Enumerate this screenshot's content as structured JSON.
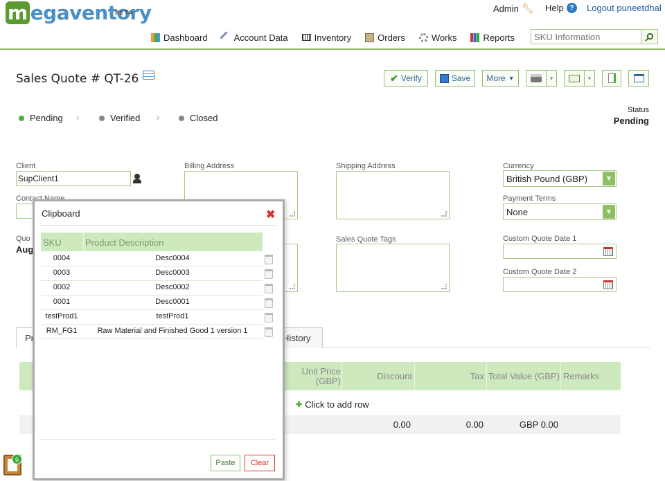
{
  "header": {
    "logo_text": "egaventory",
    "logo_m": "m",
    "logo_beta": "BETA",
    "admin": "Admin",
    "help": "Help",
    "logout": "Logout puneetdhal",
    "nav": [
      "Dashboard",
      "Account Data",
      "Inventory",
      "Orders",
      "Works",
      "Reports"
    ],
    "search_placeholder": "SKU Information"
  },
  "page": {
    "title": "Sales Quote # QT-26",
    "toolbar": {
      "verify": "Verify",
      "save": "Save",
      "more": "More"
    },
    "steps": [
      {
        "label": "Pending",
        "color": "#4caf3a"
      },
      {
        "label": "Verified",
        "color": "#888888"
      },
      {
        "label": "Closed",
        "color": "#888888"
      }
    ],
    "status_label": "Status",
    "status_value": "Pending"
  },
  "form": {
    "client_label": "Client",
    "client_value": "SupClient1",
    "contact_label": "Contact Name",
    "quote_label_partial": "Quo",
    "quote_date_partial": "Aug",
    "billing_label": "Billing Address",
    "shipping_label": "Shipping Address",
    "tags_label": "Sales Quote Tags",
    "currency_label": "Currency",
    "currency_value": "British Pound (GBP)",
    "payment_label": "Payment Terms",
    "payment_value": "None",
    "custom1_label": "Custom Quote Date 1",
    "custom2_label": "Custom Quote Date 2"
  },
  "tabs": {
    "partial": "Pr",
    "history": "History"
  },
  "grid": {
    "headers": {
      "unit_price": "Unit Price",
      "unit_price_sub": "(GBP)",
      "discount": "Discount",
      "tax": "Tax",
      "total": "Total Value (GBP)",
      "remarks": "Remarks"
    },
    "add_row": "Click to add row",
    "totals": {
      "discount": "0.00",
      "tax": "0.00",
      "total": "GBP 0.00"
    }
  },
  "clipboard": {
    "title": "Clipboard",
    "headers": {
      "sku": "SKU",
      "desc": "Product Description"
    },
    "rows": [
      {
        "sku": "0004",
        "desc": "Desc0004"
      },
      {
        "sku": "0003",
        "desc": "Desc0003"
      },
      {
        "sku": "0002",
        "desc": "Desc0002"
      },
      {
        "sku": "0001",
        "desc": "Desc0001"
      },
      {
        "sku": "testProd1",
        "desc": "testProd1"
      },
      {
        "sku": "RM_FG1",
        "desc": "Raw Material and Finished Good 1 version 1"
      }
    ],
    "paste": "Paste",
    "clear": "Clear",
    "badge": "6"
  },
  "colors": {
    "accent_green": "#8fbf63",
    "link_blue": "#1a5a9a",
    "close_red": "#d9342b"
  }
}
